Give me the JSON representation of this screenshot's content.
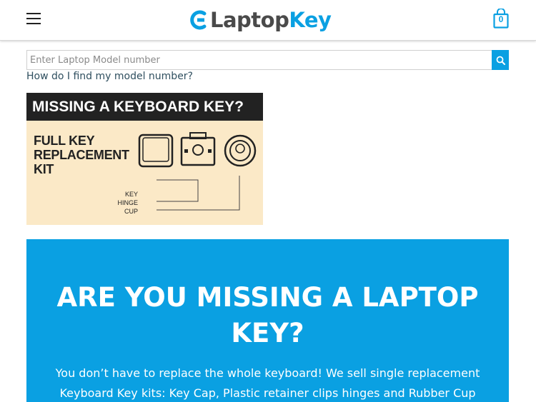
{
  "header": {
    "menu_icon": "hamburger-menu-icon",
    "logo": {
      "part1": "Laptop",
      "part2": "Key"
    },
    "cart": {
      "icon": "shopping-bag-icon",
      "count": "0"
    }
  },
  "search": {
    "placeholder": "Enter Laptop Model number",
    "value": "",
    "button_icon": "search-icon"
  },
  "help_link": "How do I find my model number?",
  "banner": {
    "headline": "MISSING A KEYBOARD KEY?",
    "kit_lines": [
      "FULL KEY",
      "REPLACEMENT",
      "KIT"
    ],
    "parts": [
      "KEY",
      "HINGE",
      "CUP"
    ]
  },
  "hero": {
    "title": "ARE YOU MISSING A LAPTOP KEY?",
    "text": "You don’t have to replace the whole keyboard! We sell single replacement Keyboard Key kits: Key Cap, Plastic retainer clips hinges and Rubber Cup"
  },
  "colors": {
    "accent": "#0aa0e2",
    "logo_gray": "#4a4a4a",
    "banner_bg": "#fbe9c7",
    "banner_dark": "#222222"
  }
}
